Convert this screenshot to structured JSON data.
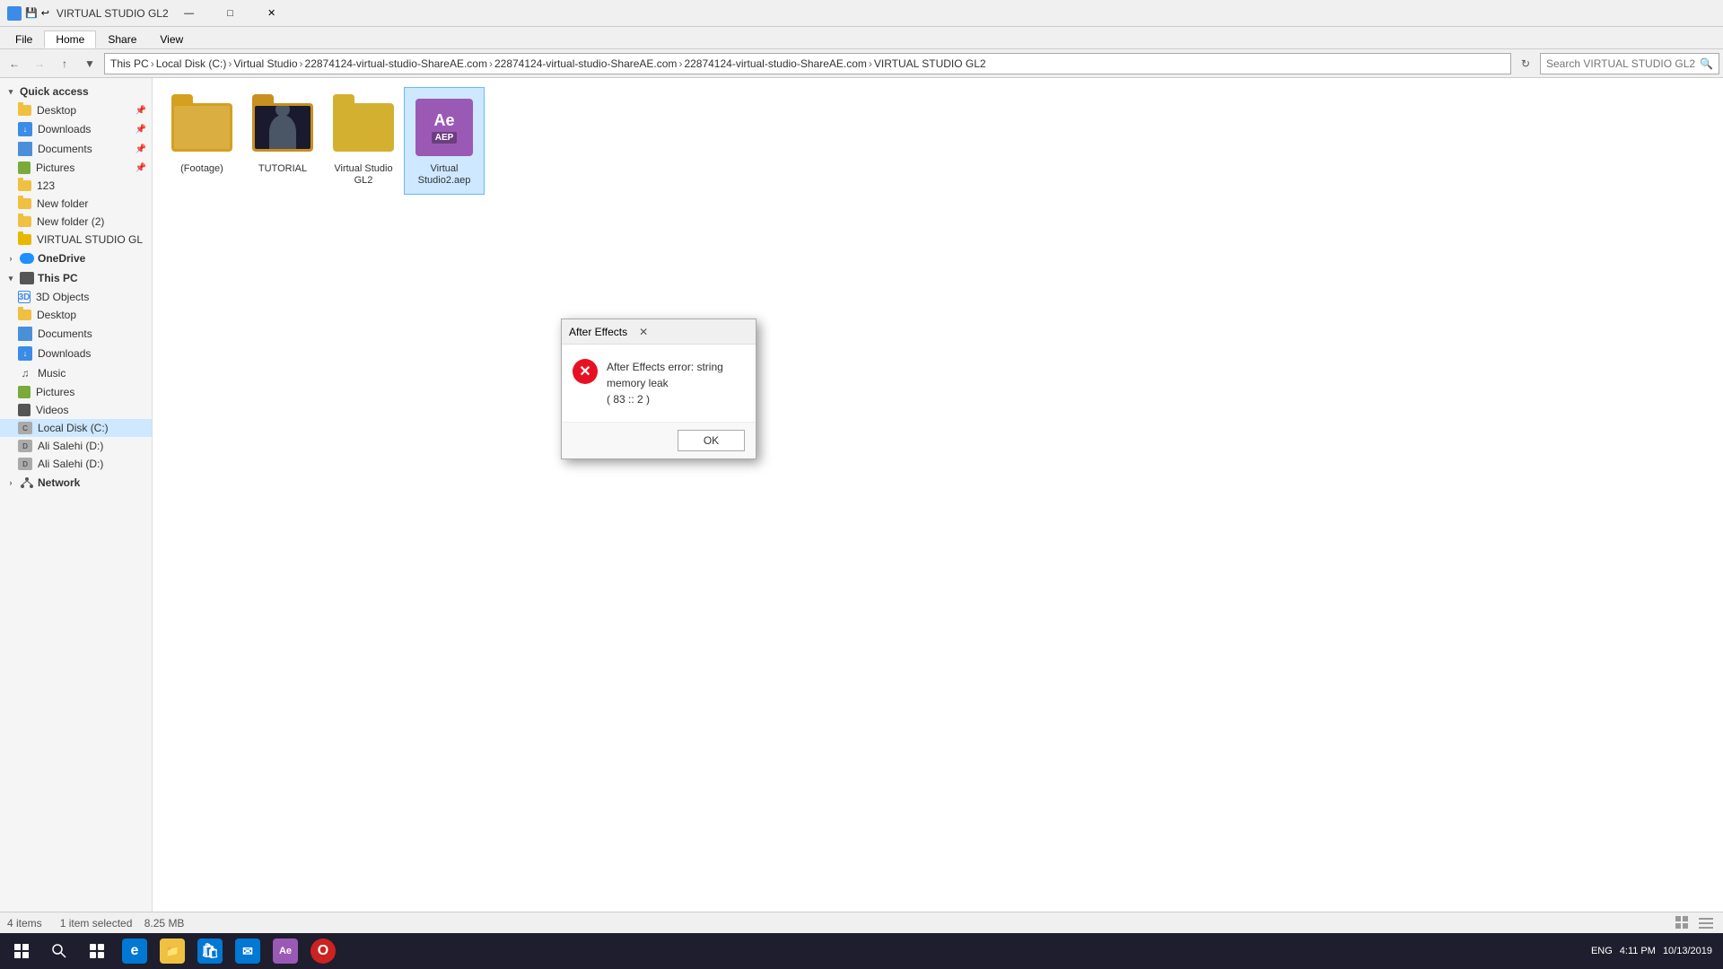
{
  "window": {
    "title": "VIRTUAL STUDIO GL2",
    "tabs": [
      "File",
      "Home",
      "Share",
      "View"
    ],
    "active_tab": "Home"
  },
  "address_bar": {
    "breadcrumbs": [
      "This PC",
      "Local Disk (C:)",
      "Virtual Studio",
      "22874124-virtual-studio-ShareAE.com",
      "22874124-virtual-studio-ShareAE.com",
      "22874124-virtual-studio-ShareAE.com",
      "VIRTUAL STUDIO GL2"
    ],
    "search_placeholder": "Search VIRTUAL STUDIO GL2"
  },
  "sidebar": {
    "quick_access": {
      "label": "Quick access",
      "items": [
        {
          "name": "Desktop",
          "pinned": true
        },
        {
          "name": "Downloads",
          "pinned": true
        },
        {
          "name": "Documents",
          "pinned": true
        },
        {
          "name": "Pictures",
          "pinned": true
        },
        {
          "name": "123"
        },
        {
          "name": "New folder"
        },
        {
          "name": "New folder (2)"
        },
        {
          "name": "VIRTUAL STUDIO GL"
        }
      ]
    },
    "onedrive": {
      "label": "OneDrive"
    },
    "this_pc": {
      "label": "This PC",
      "items": [
        {
          "name": "3D Objects"
        },
        {
          "name": "Desktop"
        },
        {
          "name": "Documents"
        },
        {
          "name": "Downloads"
        },
        {
          "name": "Music"
        },
        {
          "name": "Pictures"
        },
        {
          "name": "Videos"
        },
        {
          "name": "Local Disk (C:)",
          "selected": true
        },
        {
          "name": "Ali Salehi (D:)"
        },
        {
          "name": "Ali Salehi (D:)"
        }
      ]
    },
    "network": {
      "label": "Network"
    }
  },
  "files": [
    {
      "name": "(Footage)",
      "type": "folder"
    },
    {
      "name": "TUTORIAL",
      "type": "folder-dark"
    },
    {
      "name": "Virtual Studio GL2",
      "type": "folder"
    },
    {
      "name": "Virtual Studio2.aep",
      "type": "aep",
      "selected": true
    }
  ],
  "status_bar": {
    "item_count": "4 items",
    "selected_info": "1 item selected",
    "size": "8.25 MB"
  },
  "dialog": {
    "title": "After Effects",
    "error_message": "After Effects error: string memory leak",
    "error_code": "( 83 :: 2 )",
    "ok_label": "OK"
  },
  "taskbar": {
    "time": "4:11 PM",
    "date": "10/13/2019",
    "lang": "ENG"
  }
}
